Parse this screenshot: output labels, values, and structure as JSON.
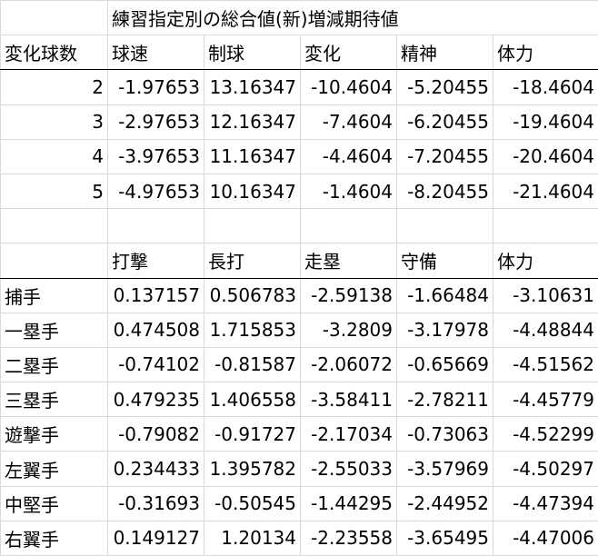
{
  "table1": {
    "title": "練習指定別の総合値(新)増減期待値",
    "corner": "変化球数",
    "headers": [
      "球速",
      "制球",
      "変化",
      "精神",
      "体力"
    ],
    "rows": [
      {
        "label": "2",
        "values": [
          "-1.97653",
          "13.16347",
          "-10.4604",
          "-5.20455",
          "-18.4604"
        ]
      },
      {
        "label": "3",
        "values": [
          "-2.97653",
          "12.16347",
          "-7.4604",
          "-6.20455",
          "-19.4604"
        ]
      },
      {
        "label": "4",
        "values": [
          "-3.97653",
          "11.16347",
          "-4.4604",
          "-7.20455",
          "-20.4604"
        ]
      },
      {
        "label": "5",
        "values": [
          "-4.97653",
          "10.16347",
          "-1.4604",
          "-8.20455",
          "-21.4604"
        ]
      }
    ]
  },
  "table2": {
    "headers": [
      "打撃",
      "長打",
      "走塁",
      "守備",
      "体力"
    ],
    "rows": [
      {
        "label": "捕手",
        "values": [
          "0.137157",
          "0.506783",
          "-2.59138",
          "-1.66484",
          "-3.10631"
        ]
      },
      {
        "label": "一塁手",
        "values": [
          "0.474508",
          "1.715853",
          "-3.2809",
          "-3.17978",
          "-4.48844"
        ]
      },
      {
        "label": "二塁手",
        "values": [
          "-0.74102",
          "-0.81587",
          "-2.06072",
          "-0.65669",
          "-4.51562"
        ]
      },
      {
        "label": "三塁手",
        "values": [
          "0.479235",
          "1.406558",
          "-3.58411",
          "-2.78211",
          "-4.45779"
        ]
      },
      {
        "label": "遊撃手",
        "values": [
          "-0.79082",
          "-0.91727",
          "-2.17034",
          "-0.73063",
          "-4.52299"
        ]
      },
      {
        "label": "左翼手",
        "values": [
          "0.234433",
          "1.395782",
          "-2.55033",
          "-3.57969",
          "-4.50297"
        ]
      },
      {
        "label": "中堅手",
        "values": [
          "-0.31693",
          "-0.50545",
          "-1.44295",
          "-2.44952",
          "-4.47394"
        ]
      },
      {
        "label": "右翼手",
        "values": [
          "0.149127",
          "1.20134",
          "-2.23558",
          "-3.65495",
          "-4.47006"
        ]
      }
    ]
  }
}
